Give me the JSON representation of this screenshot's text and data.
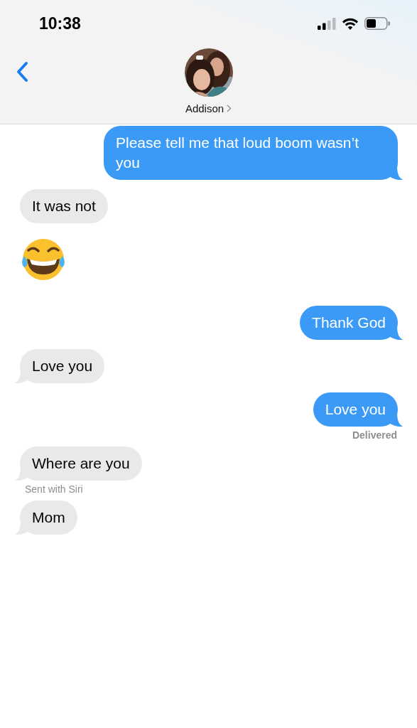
{
  "status_bar": {
    "time": "10:38"
  },
  "header": {
    "contact_name": "Addison"
  },
  "messages": [
    {
      "kind": "text",
      "sent": true,
      "text": "Please tell me that loud boom wasn’t you",
      "tail": true
    },
    {
      "kind": "text",
      "sent": false,
      "text": "It was not",
      "tail": false
    },
    {
      "kind": "emoji",
      "sent": false
    },
    {
      "kind": "text",
      "sent": true,
      "text": "Thank God",
      "tail": true
    },
    {
      "kind": "text",
      "sent": false,
      "text": "Love you",
      "tail": true
    },
    {
      "kind": "text",
      "sent": true,
      "text": "Love you",
      "tail": true
    },
    {
      "kind": "note",
      "sent": true,
      "text": "Delivered"
    },
    {
      "kind": "text",
      "sent": false,
      "text": "Where are you",
      "tail": true
    },
    {
      "kind": "note",
      "sent": false,
      "text": "Sent with Siri"
    },
    {
      "kind": "text",
      "sent": false,
      "text": "Mom",
      "tail": true
    }
  ]
}
